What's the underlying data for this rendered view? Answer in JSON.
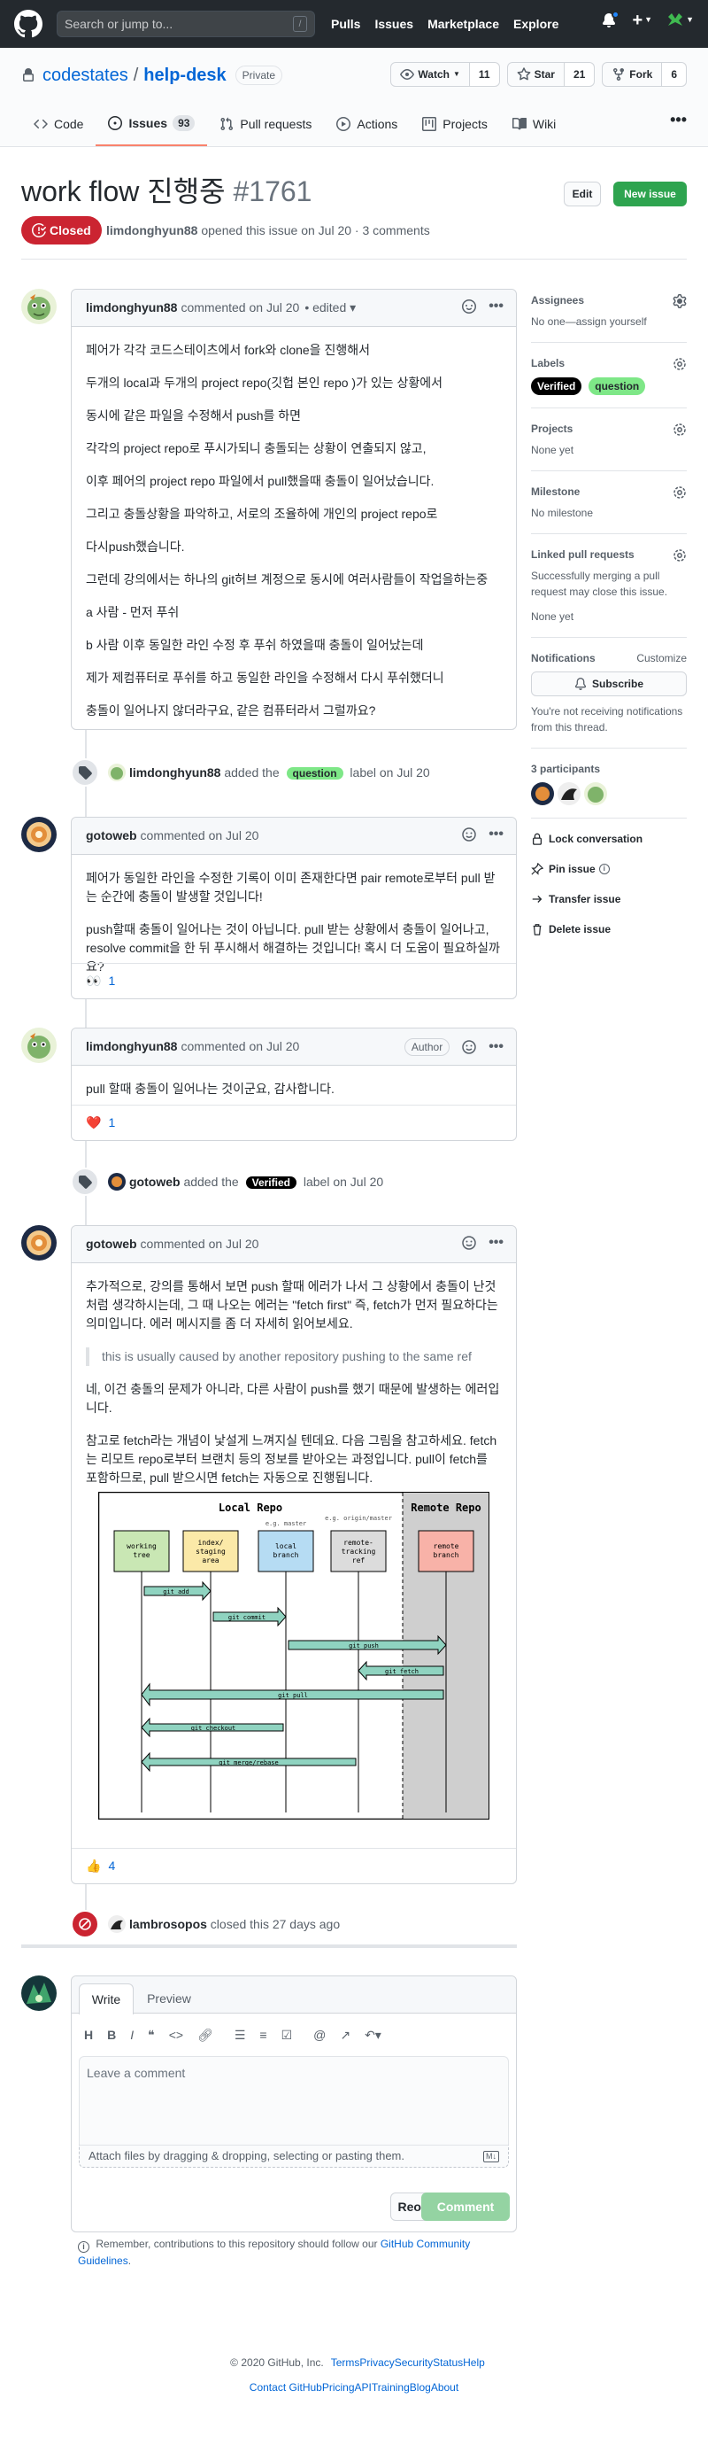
{
  "header": {
    "search_placeholder": "Search or jump to...",
    "slash_key": "/",
    "nav": [
      "Pulls",
      "Issues",
      "Marketplace",
      "Explore"
    ],
    "plus": "+"
  },
  "repo": {
    "owner": "codestates",
    "separator": "/",
    "name": "help-desk",
    "visibility": "Private",
    "watch_label": "Watch",
    "watch_count": "11",
    "star_label": "Star",
    "star_count": "21",
    "fork_label": "Fork",
    "fork_count": "6",
    "tabs": [
      {
        "label": "Code"
      },
      {
        "label": "Issues",
        "count": "93"
      },
      {
        "label": "Pull requests"
      },
      {
        "label": "Actions"
      },
      {
        "label": "Projects"
      },
      {
        "label": "Wiki"
      }
    ],
    "more": "•••"
  },
  "issue": {
    "title": "work flow 진행중",
    "number": "#1761",
    "edit_label": "Edit",
    "new_issue_label": "New issue",
    "state": "Closed",
    "author": "limdonghyun88",
    "meta_text": "opened this issue on Jul 20 · 3 comments"
  },
  "comments": [
    {
      "author": "limdonghyun88",
      "meta": "commented on Jul 20",
      "edited": "• edited ▾",
      "paragraphs": [
        "페어가 각각 코드스테이츠에서 fork와 clone을 진행해서",
        "두개의 local과 두개의 project repo(깃헙 본인 repo )가 있는 상황에서",
        "동시에 같은 파일을 수정해서 push를 하면",
        "각각의 project repo로 푸시가되니 충돌되는 상황이 연출되지 않고,",
        "이후 페어의 project repo 파일에서 pull했을때 충돌이 일어났습니다.",
        "그리고 충돌상황을 파악하고, 서로의 조율하에 개인의 project repo로",
        "다시push했습니다.",
        "그런데 강의에서는 하나의 git허브 계정으로 동시에 여러사람들이 작업을하는중",
        "a 사람 - 먼저 푸쉬",
        "b 사람 이후 동일한 라인 수정 후 푸쉬 하였을때 충돌이 일어났는데",
        "제가 제컴퓨터로 푸쉬를 하고 동일한 라인을 수정해서 다시 푸쉬했더니",
        "충돌이 일어나지 않더라구요, 같은 컴퓨터라서 그럴까요?"
      ]
    },
    {
      "author": "gotoweb",
      "meta": "commented on Jul 20",
      "paragraphs": [
        "페어가 동일한 라인을 수정한 기록이 이미 존재한다면 pair remote로부터 pull 받는 순간에 충돌이 발생할 것입니다!",
        "push할때 충돌이 일어나는 것이 아닙니다. pull 받는 상황에서 충돌이 일어나고, resolve commit을 한 뒤 푸시해서 해결하는 것입니다! 혹시 더 도움이 필요하실까요?"
      ],
      "reaction": {
        "emoji": "👀",
        "count": "1"
      }
    },
    {
      "author": "limdonghyun88",
      "meta": "commented on Jul 20",
      "badge": "Author",
      "paragraphs": [
        "pull 할때 충돌이 일어나는 것이군요, 감사합니다."
      ],
      "reaction": {
        "emoji": "❤️",
        "count": "1"
      }
    },
    {
      "author": "gotoweb",
      "meta": "commented on Jul 20",
      "paragraphs": [
        "추가적으로, 강의를 통해서 보면 push 할때 에러가 나서 그 상황에서 충돌이 난것처럼 생각하시는데, 그 때 나오는 에러는 \"fetch first\" 즉, fetch가 먼저 필요하다는 의미입니다. 에러 메시지를 좀 더 자세히 읽어보세요."
      ],
      "quote": "this is usually caused by another repository pushing to the same ref",
      "paragraphs2": [
        "네, 이건 충돌의 문제가 아니라, 다른 사람이 push를 했기 때문에 발생하는 에러입니다.",
        "참고로 fetch라는 개념이 낯설게 느껴지실 텐데요. 다음 그림을 참고하세요. fetch는 리모트 repo로부터 브랜치 등의 정보를 받아오는 과정입니다. pull이 fetch를 포함하므로, pull 받으시면 fetch는 자동으로 진행됩니다."
      ],
      "reaction": {
        "emoji": "👍",
        "count": "4"
      }
    }
  ],
  "events": {
    "label_question": {
      "actor": "limdonghyun88",
      "pre": "added the",
      "label": "question",
      "post": "label on Jul 20"
    },
    "label_verified": {
      "actor": "gotoweb",
      "pre": "added the",
      "label": "Verified",
      "post": "label on Jul 20"
    },
    "closed": {
      "actor": "lambrosopos",
      "text": "closed this 27 days ago"
    }
  },
  "diagram": {
    "local_repo": "Local Repo",
    "remote_repo": "Remote Repo",
    "eg_master": "e.g. master",
    "eg_origin": "e.g. origin/master",
    "boxes": [
      "working tree",
      "index/ staging area",
      "local branch",
      "remote- tracking ref",
      "remote branch"
    ],
    "commands": [
      "git add",
      "git commit",
      "git push",
      "git fetch",
      "git pull",
      "git checkout",
      "git merge/rebase"
    ]
  },
  "sidebar": {
    "assignees_title": "Assignees",
    "assignees_value": "No one—assign yourself",
    "labels_title": "Labels",
    "labels": [
      {
        "name": "Verified",
        "color": "#000000",
        "text": "#ffffff"
      },
      {
        "name": "question",
        "color": "#7ee787",
        "text": "#24292e"
      }
    ],
    "projects_title": "Projects",
    "projects_value": "None yet",
    "milestone_title": "Milestone",
    "milestone_value": "No milestone",
    "linked_title": "Linked pull requests",
    "linked_desc": "Successfully merging a pull request may close this issue.",
    "linked_value": "None yet",
    "notifications_title": "Notifications",
    "customize": "Customize",
    "subscribe": "Subscribe",
    "notif_desc": "You're not receiving notifications from this thread.",
    "participants_title": "3 participants",
    "actions": [
      "Lock conversation",
      "Pin issue",
      "Transfer issue",
      "Delete issue"
    ]
  },
  "editor": {
    "write_tab": "Write",
    "preview_tab": "Preview",
    "placeholder": "Leave a comment",
    "attach_text": "Attach files by dragging & dropping, selecting or pasting them.",
    "reopen": "Reopen issue",
    "comment": "Comment",
    "note_pre": "Remember, contributions to this repository should follow our",
    "note_link": "GitHub Community Guidelines",
    "note_post": "."
  },
  "footer": {
    "copyright": "© 2020 GitHub, Inc.",
    "row1": [
      "Terms",
      "Privacy",
      "Security",
      "Status",
      "Help"
    ],
    "row2": [
      "Contact GitHub",
      "Pricing",
      "API",
      "Training",
      "Blog",
      "About"
    ]
  },
  "colors": {
    "header_bg": "#24292e",
    "closed": "#cb2431",
    "green": "#2ea44f",
    "link": "#0366d6"
  }
}
